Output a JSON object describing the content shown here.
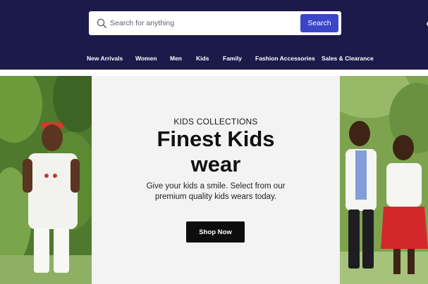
{
  "search": {
    "placeholder": "Search for anything",
    "button_label": "Search"
  },
  "nav": {
    "items": [
      {
        "label": "New Arrivals"
      },
      {
        "label": "Women"
      },
      {
        "label": "Men"
      },
      {
        "label": "Kids"
      },
      {
        "label": "Family"
      },
      {
        "label": "Fashion Accessories"
      },
      {
        "label": "Sales & Clearance"
      }
    ]
  },
  "hero": {
    "eyebrow": "KIDS COLLECTIONS",
    "headline_line1": "Finest Kids",
    "headline_line2": "wear",
    "subtext": "Give your kids a smile. Select from our premium quality kids wears today.",
    "cta_label": "Shop Now"
  },
  "colors": {
    "header_bg": "#1c1a4b",
    "search_button": "#3b45c9",
    "cta_bg": "#0d0d0d",
    "hero_bg": "#f3f3f3"
  }
}
